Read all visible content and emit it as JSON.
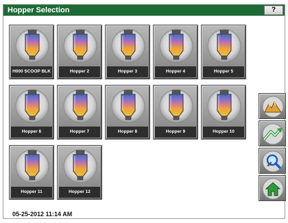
{
  "window": {
    "title": "Hopper Selection",
    "help_label": "?"
  },
  "hoppers": [
    {
      "label": "H000 SCOOP BLK"
    },
    {
      "label": "Hopper 2"
    },
    {
      "label": "Hopper 3"
    },
    {
      "label": "Hopper 4"
    },
    {
      "label": "Hopper 5"
    },
    {
      "label": "Hopper 6"
    },
    {
      "label": "Hopper 7"
    },
    {
      "label": "Hopper 8"
    },
    {
      "label": "Hopper 9"
    },
    {
      "label": "Hopper 10"
    },
    {
      "label": "Hopper 11"
    },
    {
      "label": "Hopper 12"
    }
  ],
  "side_buttons": [
    {
      "icon": "material-pile-icon"
    },
    {
      "icon": "trend-arrows-icon"
    },
    {
      "icon": "wrench-magnifier-icon"
    },
    {
      "icon": "home-icon"
    }
  ],
  "status": {
    "datetime": "05-25-2012 11:14 AM"
  },
  "colors": {
    "titlebar": "#1e6a36",
    "label_bg": "#2d2d2d",
    "home_green": "#2e9a3c"
  }
}
